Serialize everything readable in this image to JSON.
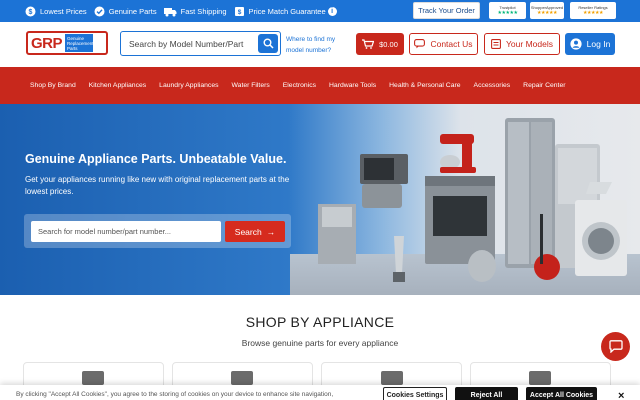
{
  "promo": {
    "items": [
      {
        "label": "Lowest Prices",
        "icon": "dollar-badge-icon"
      },
      {
        "label": "Genuine Parts",
        "icon": "shield-check-icon"
      },
      {
        "label": "Fast Shipping",
        "icon": "truck-icon"
      },
      {
        "label": "Price Match Guarantee",
        "icon": "price-tag-icon"
      }
    ],
    "info_label": "i",
    "track_order_label": "Track Your Order",
    "trust_badges": [
      {
        "name": "Trustpilot",
        "stars": 5
      },
      {
        "name": "ShopperApproved",
        "stars": 5
      },
      {
        "name": "Reseller Ratings",
        "stars": 5
      }
    ]
  },
  "header": {
    "logo_text": "GRP",
    "logo_sub": "Genuine Replacement Parts",
    "search_placeholder": "Search by Model Number/Part",
    "where_to_find_label": "Where to find my model number?",
    "cart_total": "$0.00",
    "contact_label": "Contact Us",
    "models_label": "Your Models",
    "login_label": "Log In"
  },
  "nav": {
    "items": [
      "Shop By Brand",
      "Kitchen Appliances",
      "Laundry Appliances",
      "Water Filters",
      "Electronics",
      "Hardware Tools",
      "Health & Personal Care",
      "Accessories",
      "Repair Center"
    ]
  },
  "hero": {
    "title": "Genuine Appliance Parts. Unbeatable Value.",
    "subtitle": "Get your appliances running like new with original replacement parts at the lowest prices.",
    "search_placeholder": "Search for model number/part number...",
    "search_button": "Search",
    "search_button_arrow": "→"
  },
  "shop": {
    "title": "SHOP BY APPLIANCE",
    "subtitle": "Browse genuine parts for every appliance"
  },
  "cookie": {
    "text": "By clicking \"Accept All Cookies\", you agree to the storing of cookies on your device to enhance site navigation,",
    "settings_label": "Cookies Settings",
    "reject_label": "Reject All",
    "accept_label": "Accept All Cookies",
    "close_label": "×"
  },
  "colors": {
    "brand_blue": "#1c73d6",
    "brand_red": "#c8281c"
  }
}
